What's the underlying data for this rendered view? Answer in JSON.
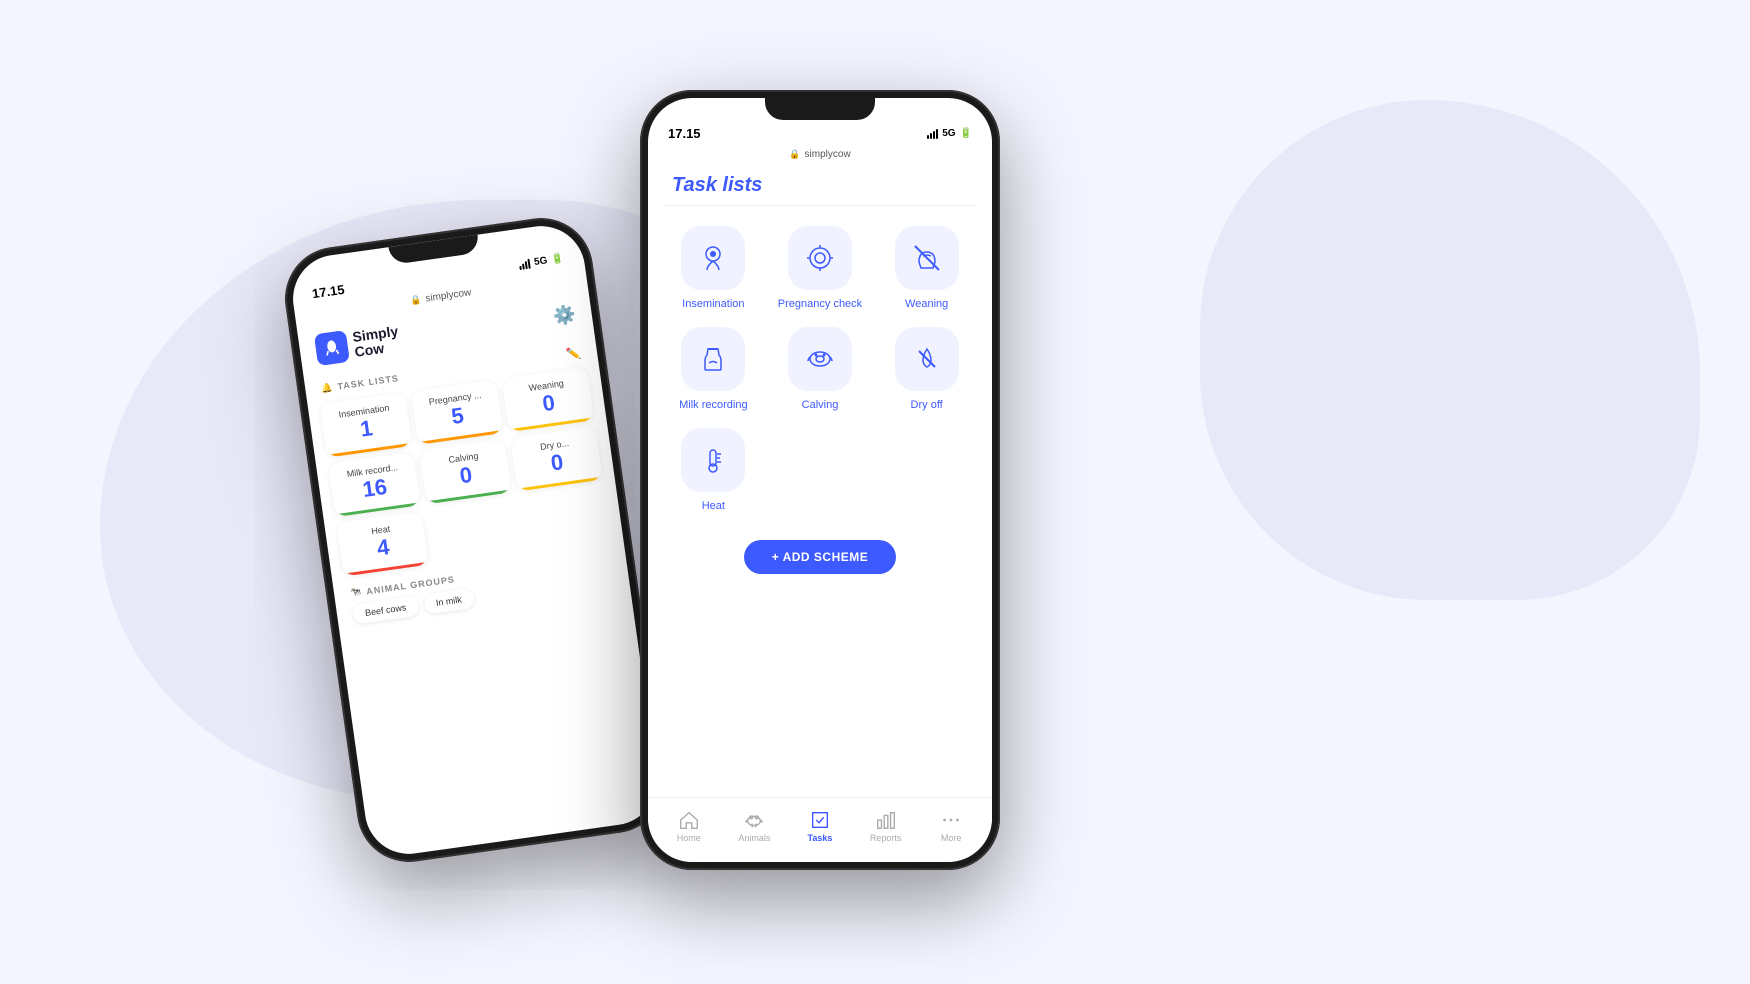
{
  "background": {
    "color": "#f0f0fa"
  },
  "phone_back": {
    "status": {
      "time": "17.15",
      "signal": "5G",
      "url": "simplycow"
    },
    "header": {
      "logo_label": "Simply\nCow",
      "menu_icon": "⋮⋮"
    },
    "sections": {
      "task_lists_label": "TASK LISTS",
      "task_cards": [
        {
          "label": "Insemination",
          "number": "1",
          "bar": "bar-orange"
        },
        {
          "label": "Pregnancy ...",
          "number": "5",
          "bar": "bar-orange"
        },
        {
          "label": "Weaning",
          "number": "0",
          "bar": "bar-yellow"
        },
        {
          "label": "Milk record...",
          "number": "16",
          "bar": "bar-green"
        },
        {
          "label": "Calving",
          "number": "0",
          "bar": "bar-green"
        },
        {
          "label": "Dry o...",
          "number": "0",
          "bar": "bar-yellow"
        },
        {
          "label": "Heat",
          "number": "4",
          "bar": "bar-red"
        }
      ],
      "animal_groups_label": "ANIMAL GROUPS",
      "animal_tags": [
        "Beef cows",
        "In milk"
      ]
    }
  },
  "phone_front": {
    "status": {
      "time": "17.15",
      "signal": "5G",
      "url": "simplycow"
    },
    "page_title": "Task lists",
    "task_items": [
      {
        "id": "insemination",
        "label": "Insemination",
        "icon": "insemination"
      },
      {
        "id": "pregnancy-check",
        "label": "Pregnancy\ncheck",
        "icon": "pregnancy"
      },
      {
        "id": "weaning",
        "label": "Weaning",
        "icon": "weaning"
      },
      {
        "id": "milk-recording",
        "label": "Milk recording",
        "icon": "milk"
      },
      {
        "id": "calving",
        "label": "Calving",
        "icon": "calving"
      },
      {
        "id": "dry-off",
        "label": "Dry off",
        "icon": "dry-off"
      },
      {
        "id": "heat",
        "label": "Heat",
        "icon": "heat"
      }
    ],
    "add_scheme_label": "+ ADD SCHEME",
    "nav": [
      {
        "id": "home",
        "label": "Home",
        "active": false
      },
      {
        "id": "animals",
        "label": "Animals",
        "active": false
      },
      {
        "id": "tasks",
        "label": "Tasks",
        "active": true
      },
      {
        "id": "reports",
        "label": "Reports",
        "active": false
      },
      {
        "id": "more",
        "label": "More",
        "active": false
      }
    ]
  }
}
